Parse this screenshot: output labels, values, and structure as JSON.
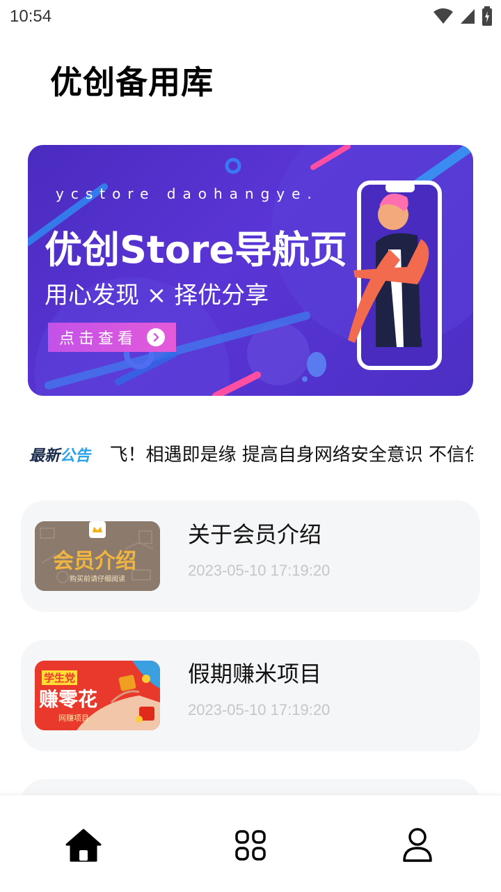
{
  "status_bar": {
    "time": "10:54",
    "icons": [
      "wifi-icon",
      "signal-icon",
      "battery-charging-icon"
    ]
  },
  "header": {
    "title": "优创备用库"
  },
  "banner": {
    "subtitle": "ycstore daohangye.",
    "title": "优创Store导航页",
    "tagline": "用心发现 × 择优分享",
    "button_label": "点击查看"
  },
  "notice": {
    "badge_part1": "最新",
    "badge_part2": "公告",
    "text": "飞！相遇即是缘 提高自身网络安全意识 不信任"
  },
  "articles": [
    {
      "title": "关于会员介绍",
      "date": "2023-05-10 17:19:20",
      "thumb_text": "会员介绍",
      "thumb_subtext": "购买前请仔细阅读"
    },
    {
      "title": "假期赚米项目",
      "date": "2023-05-10 17:19:20",
      "thumb_tag": "学生党",
      "thumb_text": "赚零花",
      "thumb_subtext": "网赚项目"
    }
  ],
  "bottom_nav": {
    "items": [
      "home-icon",
      "apps-grid-icon",
      "profile-icon"
    ]
  },
  "colors": {
    "banner_bg": "#4a2bbf",
    "accent_blue": "#2aa3e8",
    "button_pink": "#d957e0",
    "card_bg": "#f5f6f8",
    "date_gray": "#c4c6ca"
  }
}
